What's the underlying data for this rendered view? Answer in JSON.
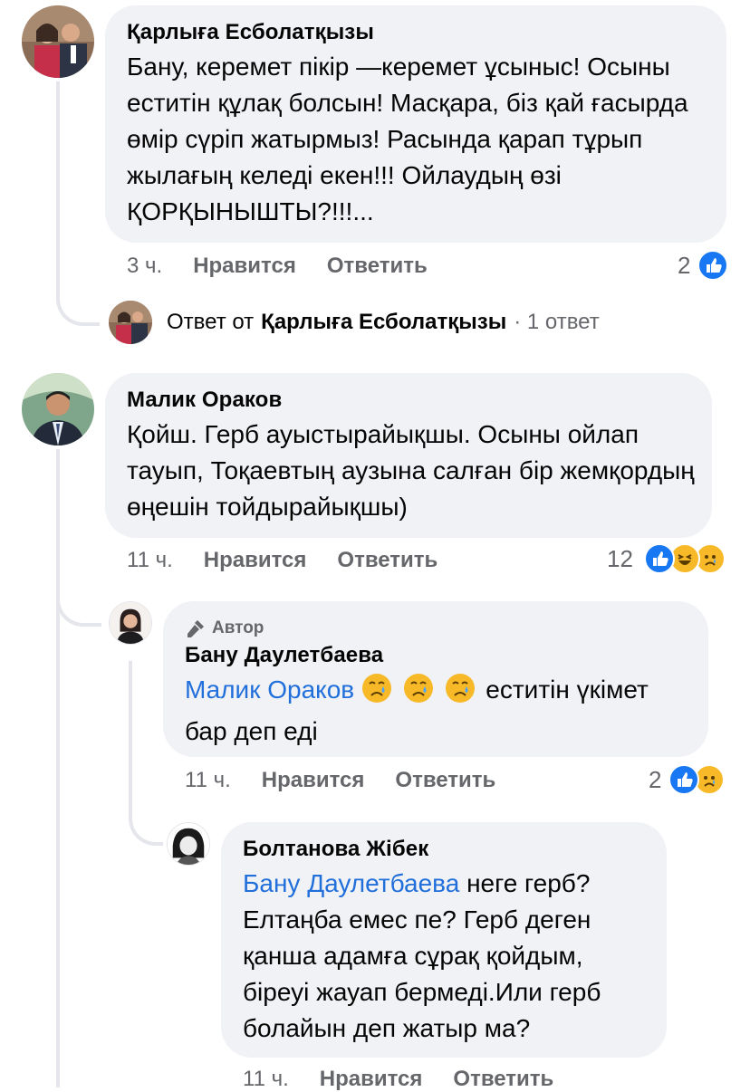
{
  "comments": [
    {
      "author": "Қарлыға Есболатқызы",
      "text": "Бану, керемет пікір —керемет ұсыныс! Осыны еститін құлақ болсын! Масқара, біз қай ғасырда өмір сүріп жатырмыз! Расында қарап тұрып жылағың келеді екен!!! Ойлаудың өзі ҚОРҚЫНЫШТЫ?!!!...",
      "time": "3 ч.",
      "like_label": "Нравится",
      "reply_label": "Ответить",
      "reaction_count": "2",
      "reactions": [
        "like"
      ],
      "reply_summary": {
        "prefix": "Ответ от",
        "name": "Қарлыға Есболатқызы",
        "suffix": "· 1 ответ"
      }
    },
    {
      "author": "Малик Ораков",
      "text": "Қойш. Герб ауыстырайықшы. Осыны ойлап тауып, Тоқаевтың аузына салған бір жемқордың өңешін тойдырайықшы)",
      "time": "11 ч.",
      "like_label": "Нравится",
      "reply_label": "Ответить",
      "reaction_count": "12",
      "reactions": [
        "like",
        "haha",
        "sad"
      ]
    },
    {
      "badge": "Автор",
      "author": "Бану Даулетбаева",
      "mention": "Малик Ораков",
      "emojis": [
        "😢",
        "😢",
        "😢"
      ],
      "text": "еститін үкімет бар деп еді",
      "time": "11 ч.",
      "like_label": "Нравится",
      "reply_label": "Ответить",
      "reaction_count": "2",
      "reactions": [
        "like",
        "sad"
      ]
    },
    {
      "author": "Болтанова Жібек",
      "mention": "Бану Даулетбаева",
      "text": "неге герб? Елтаңба емес пе? Герб деген қанша адамға сұрақ қойдым, біреуі жауап бермеді.Или герб болайын деп жатыр ма?",
      "time": "11 ч.",
      "like_label": "Нравится",
      "reply_label": "Ответить"
    }
  ],
  "colors": {
    "like": "#1877f2",
    "reaction_yellow": "#f7b928",
    "bubble": "#f0f2f5",
    "mention": "#216fdb",
    "meta": "#65676b"
  }
}
